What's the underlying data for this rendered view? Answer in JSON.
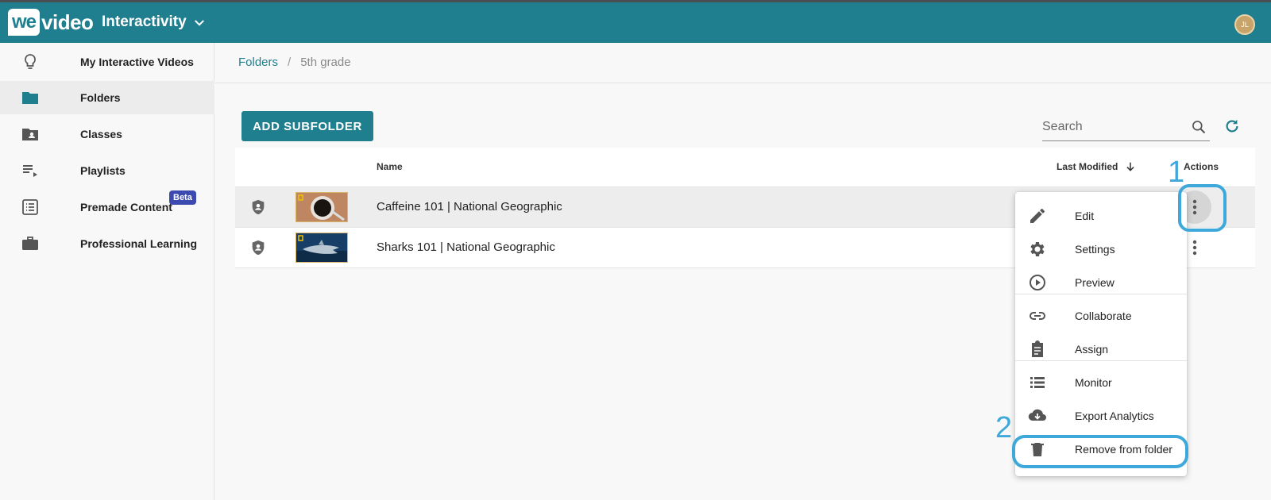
{
  "topbar": {
    "logo_we": "we",
    "logo_video": "video",
    "app_title": "Interactivity",
    "avatar_initials": "JL",
    "brand_color": "#207f8e"
  },
  "sidebar": {
    "items": [
      {
        "label": "My Interactive Videos",
        "icon": "lightbulb-icon"
      },
      {
        "label": "Folders",
        "icon": "folder-icon",
        "active": true
      },
      {
        "label": "Classes",
        "icon": "class-folder-icon"
      },
      {
        "label": "Playlists",
        "icon": "playlist-icon"
      },
      {
        "label": "Premade Content",
        "icon": "list-icon",
        "badge": "Beta"
      },
      {
        "label": "Professional Learning",
        "icon": "briefcase-icon"
      }
    ]
  },
  "breadcrumb": {
    "root": "Folders",
    "separator": "/",
    "current": "5th grade"
  },
  "toolbar": {
    "add_subfolder_label": "ADD SUBFOLDER",
    "search_placeholder": "Search"
  },
  "table": {
    "columns": {
      "name": "Name",
      "last_modified": "Last Modified",
      "actions": "Actions"
    },
    "rows": [
      {
        "name": "Caffeine 101 | National Geographic"
      },
      {
        "name": "Sharks 101 | National Geographic"
      }
    ]
  },
  "menu": {
    "items": [
      {
        "label": "Edit",
        "icon": "pencil-icon"
      },
      {
        "label": "Settings",
        "icon": "gear-icon"
      },
      {
        "label": "Preview",
        "icon": "play-circle-icon"
      },
      {
        "label": "Collaborate",
        "icon": "link-icon"
      },
      {
        "label": "Assign",
        "icon": "clipboard-icon"
      },
      {
        "label": "Monitor",
        "icon": "list-view-icon"
      },
      {
        "label": "Export Analytics",
        "icon": "cloud-download-icon"
      },
      {
        "label": "Remove from folder",
        "icon": "trash-icon"
      }
    ]
  },
  "annotations": {
    "step1": "1",
    "step2": "2",
    "highlight_color": "#3fa8da"
  }
}
